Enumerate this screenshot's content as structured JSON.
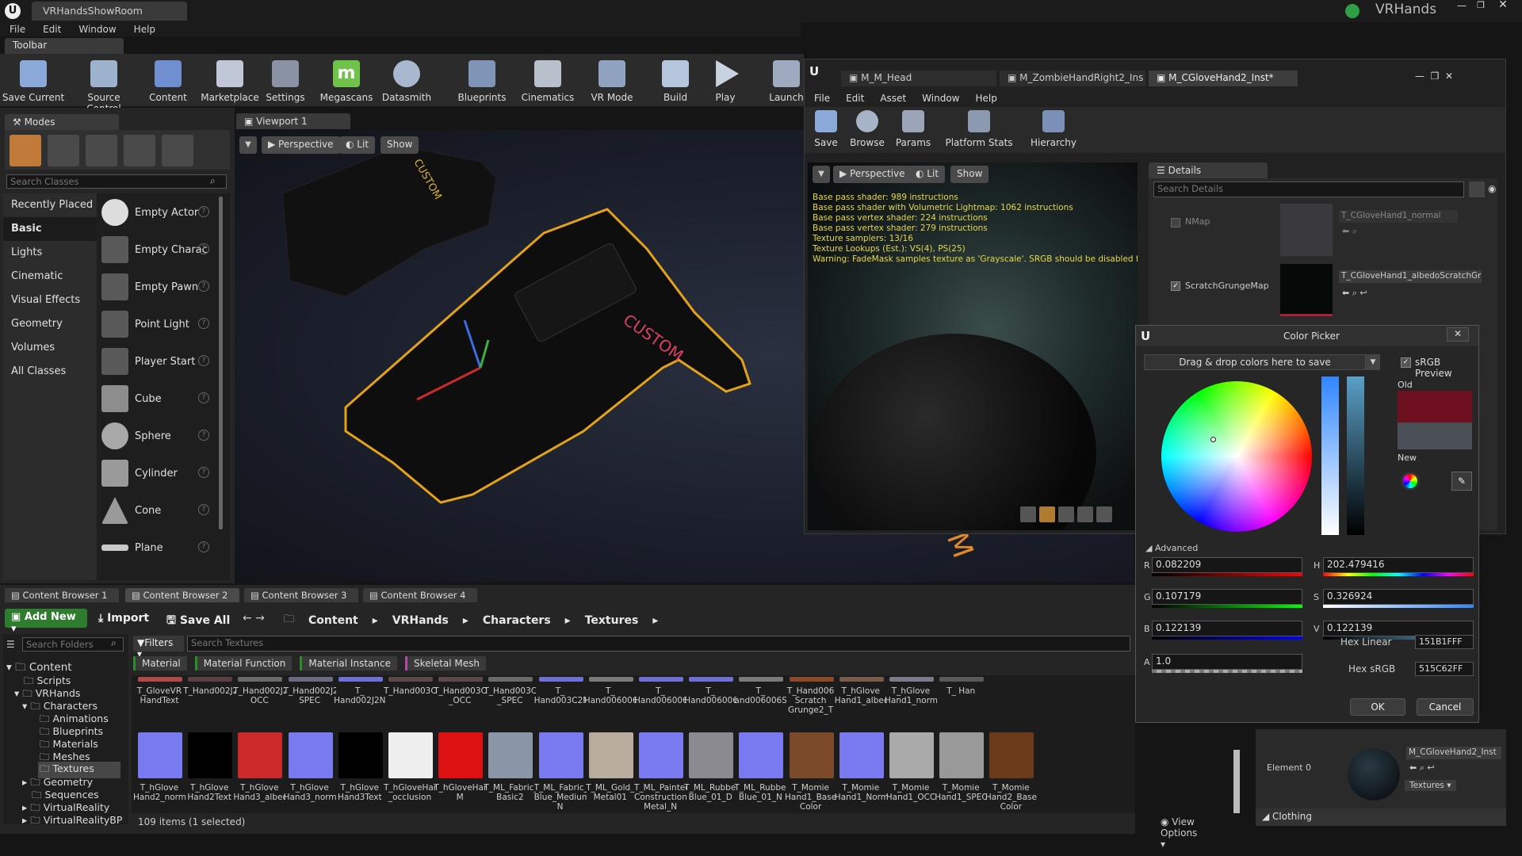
{
  "app": {
    "project_tab": "VRHandsShowRoom",
    "brand": "VRHands",
    "menu": [
      "File",
      "Edit",
      "Window",
      "Help"
    ]
  },
  "toolbar": {
    "title": "Toolbar",
    "buttons": [
      "Save Current",
      "Source Control",
      "Content",
      "Marketplace",
      "Settings",
      "Megascans",
      "Datasmith",
      "Blueprints",
      "Cinematics",
      "VR Mode",
      "Build",
      "Play",
      "Launch"
    ]
  },
  "modes": {
    "title": "Modes",
    "search_placeholder": "Search Classes",
    "categories": [
      "Recently Placed",
      "Basic",
      "Lights",
      "Cinematic",
      "Visual Effects",
      "Geometry",
      "Volumes",
      "All Classes"
    ],
    "items": [
      "Empty Actor",
      "Empty Charac",
      "Empty Pawn",
      "Point Light",
      "Player Start",
      "Cube",
      "Sphere",
      "Cylinder",
      "Cone",
      "Plane"
    ]
  },
  "viewport": {
    "tab": "Viewport 1",
    "perspective": "Perspective",
    "lit": "Lit",
    "show": "Show",
    "decal1": "CUSTOM",
    "decal2": "CUSTOM",
    "decal3": "OM"
  },
  "material_editor": {
    "tabs": [
      "M_M_Head",
      "M_ZombieHandRight2_Ins",
      "M_CGloveHand2_Inst*"
    ],
    "menu": [
      "File",
      "Edit",
      "Asset",
      "Window",
      "Help"
    ],
    "toolbar": [
      "Save",
      "Browse",
      "Params",
      "Platform Stats",
      "Hierarchy"
    ],
    "preview": {
      "perspective": "Perspective",
      "lit": "Lit",
      "show": "Show"
    },
    "stats": [
      "Base pass shader: 989 instructions",
      "Base pass shader with Volumetric Lightmap: 1062 instructions",
      "Base pass vertex shader: 224 instructions",
      "Base pass vertex shader: 279 instructions",
      "Texture samplers: 13/16",
      "Texture Lookups (Est.): VS(4), PS(25)",
      "Warning: FadeMask samples texture as 'Grayscale'. SRGB should be disabled for '/G"
    ]
  },
  "details": {
    "title": "Details",
    "search_placeholder": "Search Details",
    "nmap_label": "NMap",
    "nmap_value": "T_CGloveHand1_normal",
    "scratch_label": "ScratchGrungeMap",
    "scratch_value": "T_CGloveHand1_albedoScratchGr",
    "element_label": "Element 0",
    "element_value": "M_CGloveHand2_Inst",
    "textures_btn": "Textures",
    "clothing": "Clothing"
  },
  "color_picker": {
    "title": "Color Picker",
    "drag_drop": "Drag & drop colors here to save",
    "srgb_preview": "sRGB Preview",
    "old_label": "Old",
    "new_label": "New",
    "advanced": "Advanced",
    "old_color": "#6f1021",
    "new_color": "#4b5058",
    "R": "0.082209",
    "G": "0.107179",
    "B": "0.122139",
    "A": "1.0",
    "H": "202.479416",
    "S": "0.326924",
    "V": "0.122139",
    "hex_linear_label": "Hex Linear",
    "hex_linear": "151B1FFF",
    "hex_srgb_label": "Hex sRGB",
    "hex_srgb": "515C62FF",
    "ok": "OK",
    "cancel": "Cancel"
  },
  "content_browser": {
    "tabs": [
      "Content Browser 1",
      "Content Browser 2",
      "Content Browser 3",
      "Content Browser 4"
    ],
    "add_new": "Add New",
    "import": "Import",
    "save_all": "Save All",
    "breadcrumb": [
      "Content",
      "VRHands",
      "Characters",
      "Textures"
    ],
    "search_folders": "Search Folders",
    "filters": "Filters",
    "search_textures": "Search Textures",
    "filter_chips": [
      "Material",
      "Material Function",
      "Material Instance",
      "Skeletal Mesh"
    ],
    "tree": [
      "Content",
      "Scripts",
      "VRHands",
      "Characters",
      "Animations",
      "Blueprints",
      "Materials",
      "Meshes",
      "Textures",
      "Geometry",
      "Sequences",
      "VirtualReality",
      "VirtualRealityBP"
    ],
    "row1": [
      "T_GloveVR HandText",
      "T_Hand002J2",
      "T_Hand002J2_ OCC",
      "T_Hand002J2_ SPEC",
      "T_ Hand002J2N",
      "T_Hand003C2",
      "T_Hand003C2 _OCC",
      "T_Hand003C2 _SPEC",
      "T_ Hand003C2N",
      "T_ Hand006006AO",
      "T_ Hand006006D",
      "T_ Hand006006N",
      "T_ and006006SPE",
      "T_Hand006 Scratch Grunge2_T",
      "T_hGlove Hand1_albedo",
      "T_hGlove Hand1_normal",
      "T_ Han"
    ],
    "row2": [
      "T_hGlove Hand2_normal",
      "T_hGlove Hand2Text",
      "T_hGlove Hand3_albedo",
      "T_hGlove Hand3_normal",
      "T_hGlove Hand3Text",
      "T_hGloveHand _occlusion",
      "T_hGloveHand M",
      "T_ML_Fabric_ Basic2",
      "T_ML_Fabric_ Blue_Medium_ N",
      "T_ML_Gold_ Metal01",
      "T_ML_Painted Construction Metal_N",
      "T_ML_Rubber_ Blue_01_D",
      "T_ML_Rubber_ Blue_01_N",
      "T_Momie Hand1_Base Color",
      "T_Momie Hand1_Normal",
      "T_Momie Hand1_OCC",
      "T_Momie Hand1_SPEC",
      "T_Momie Hand2_Base Color"
    ],
    "status": "109 items (1 selected)",
    "view_options": "View Options"
  }
}
